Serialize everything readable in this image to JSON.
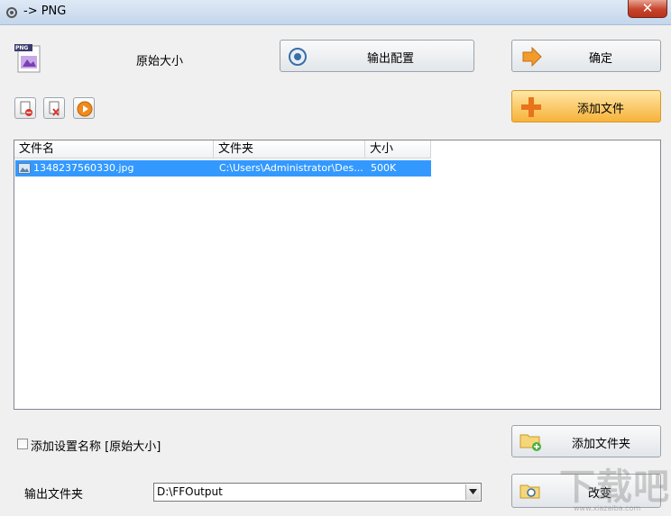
{
  "window": {
    "title": "-> PNG",
    "close_symbol": "✕"
  },
  "header": {
    "format_badge": "PNG",
    "size_label": "原始大小"
  },
  "toolbar": {
    "output_config_label": "输出配置",
    "ok_label": "确定",
    "add_file_label": "添加文件"
  },
  "file_list": {
    "columns": [
      "文件名",
      "文件夹",
      "大小"
    ],
    "rows": [
      {
        "name": "1348237560330.jpg",
        "folder": "C:\\Users\\Administrator\\Des...",
        "size": "500K",
        "selected": true
      }
    ]
  },
  "options": {
    "add_setting_name_label": "添加设置名称 [原始大小]",
    "add_setting_name_checked": false,
    "add_folder_label": "添加文件夹",
    "output_folder_label": "输出文件夹",
    "output_folder_value": "D:\\FFOutput",
    "change_label": "改变"
  },
  "watermark": {
    "text": "下载吧",
    "sub": "www.xiazaiba.com"
  },
  "colors": {
    "selection": "#3399ff",
    "accent_button": "#f7b23a",
    "close_button": "#c7432b"
  },
  "icons": [
    "window-icon",
    "png-format-icon",
    "config-gear-icon",
    "arrow-right-icon",
    "plus-icon",
    "remove-file-icon",
    "delete-file-icon",
    "play-icon",
    "image-file-icon",
    "folder-add-icon",
    "folder-change-icon",
    "dropdown-arrow-icon"
  ]
}
